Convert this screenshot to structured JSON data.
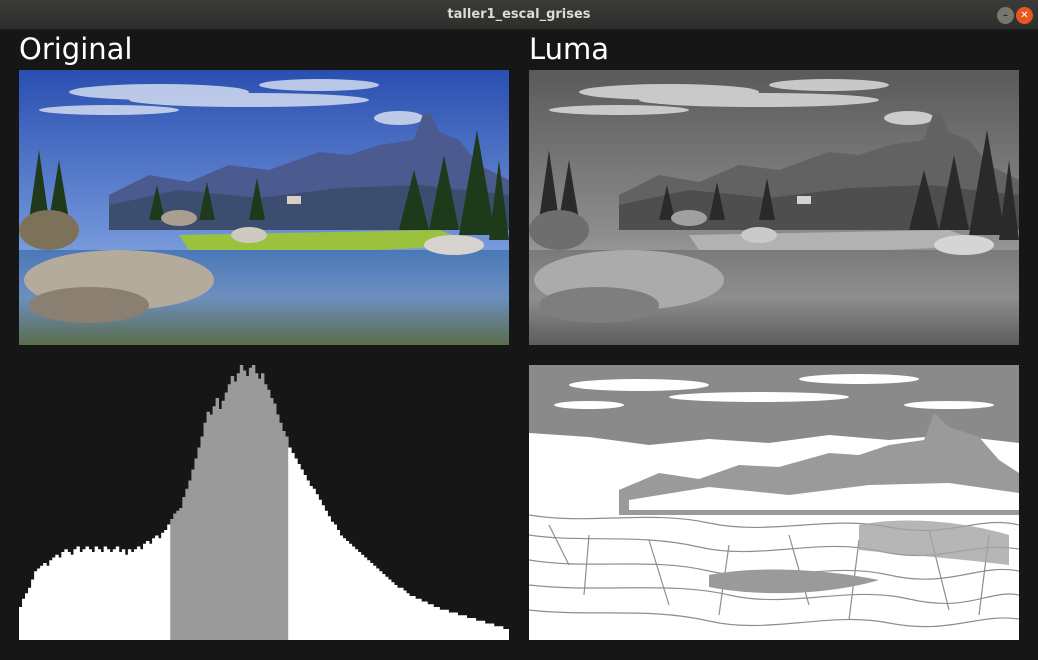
{
  "window": {
    "title": "taller1_escal_grises"
  },
  "panels": {
    "original_label": "Original",
    "luma_label": "Luma"
  },
  "icons": {
    "minimize": "minimize-icon",
    "close": "close-icon"
  },
  "histogram": {
    "bar_color": "#ffffff",
    "highlight_color": "#9a9a9a",
    "background": "#161616",
    "bins": [
      0.12,
      0.15,
      0.17,
      0.19,
      0.22,
      0.25,
      0.26,
      0.27,
      0.28,
      0.27,
      0.29,
      0.3,
      0.31,
      0.3,
      0.32,
      0.33,
      0.32,
      0.31,
      0.33,
      0.34,
      0.32,
      0.33,
      0.34,
      0.33,
      0.32,
      0.34,
      0.33,
      0.32,
      0.34,
      0.33,
      0.32,
      0.33,
      0.34,
      0.32,
      0.33,
      0.31,
      0.33,
      0.32,
      0.33,
      0.34,
      0.33,
      0.35,
      0.36,
      0.35,
      0.37,
      0.38,
      0.37,
      0.39,
      0.4,
      0.42,
      0.44,
      0.46,
      0.47,
      0.48,
      0.52,
      0.55,
      0.58,
      0.62,
      0.66,
      0.7,
      0.74,
      0.79,
      0.83,
      0.82,
      0.85,
      0.88,
      0.84,
      0.87,
      0.9,
      0.93,
      0.96,
      0.94,
      0.97,
      1.0,
      0.98,
      0.96,
      0.99,
      1.0,
      0.97,
      0.95,
      0.97,
      0.93,
      0.91,
      0.88,
      0.86,
      0.82,
      0.79,
      0.76,
      0.74,
      0.7,
      0.68,
      0.66,
      0.64,
      0.62,
      0.6,
      0.58,
      0.56,
      0.55,
      0.53,
      0.51,
      0.49,
      0.47,
      0.45,
      0.43,
      0.42,
      0.4,
      0.38,
      0.37,
      0.36,
      0.35,
      0.34,
      0.33,
      0.32,
      0.31,
      0.3,
      0.29,
      0.28,
      0.27,
      0.26,
      0.25,
      0.24,
      0.23,
      0.22,
      0.21,
      0.2,
      0.19,
      0.19,
      0.18,
      0.17,
      0.16,
      0.16,
      0.15,
      0.15,
      0.14,
      0.14,
      0.13,
      0.13,
      0.12,
      0.12,
      0.11,
      0.11,
      0.11,
      0.1,
      0.1,
      0.1,
      0.09,
      0.09,
      0.09,
      0.08,
      0.08,
      0.08,
      0.07,
      0.07,
      0.07,
      0.06,
      0.06,
      0.06,
      0.05,
      0.05,
      0.05,
      0.04,
      0.04
    ],
    "highlight_range": [
      0.31,
      0.55
    ]
  }
}
